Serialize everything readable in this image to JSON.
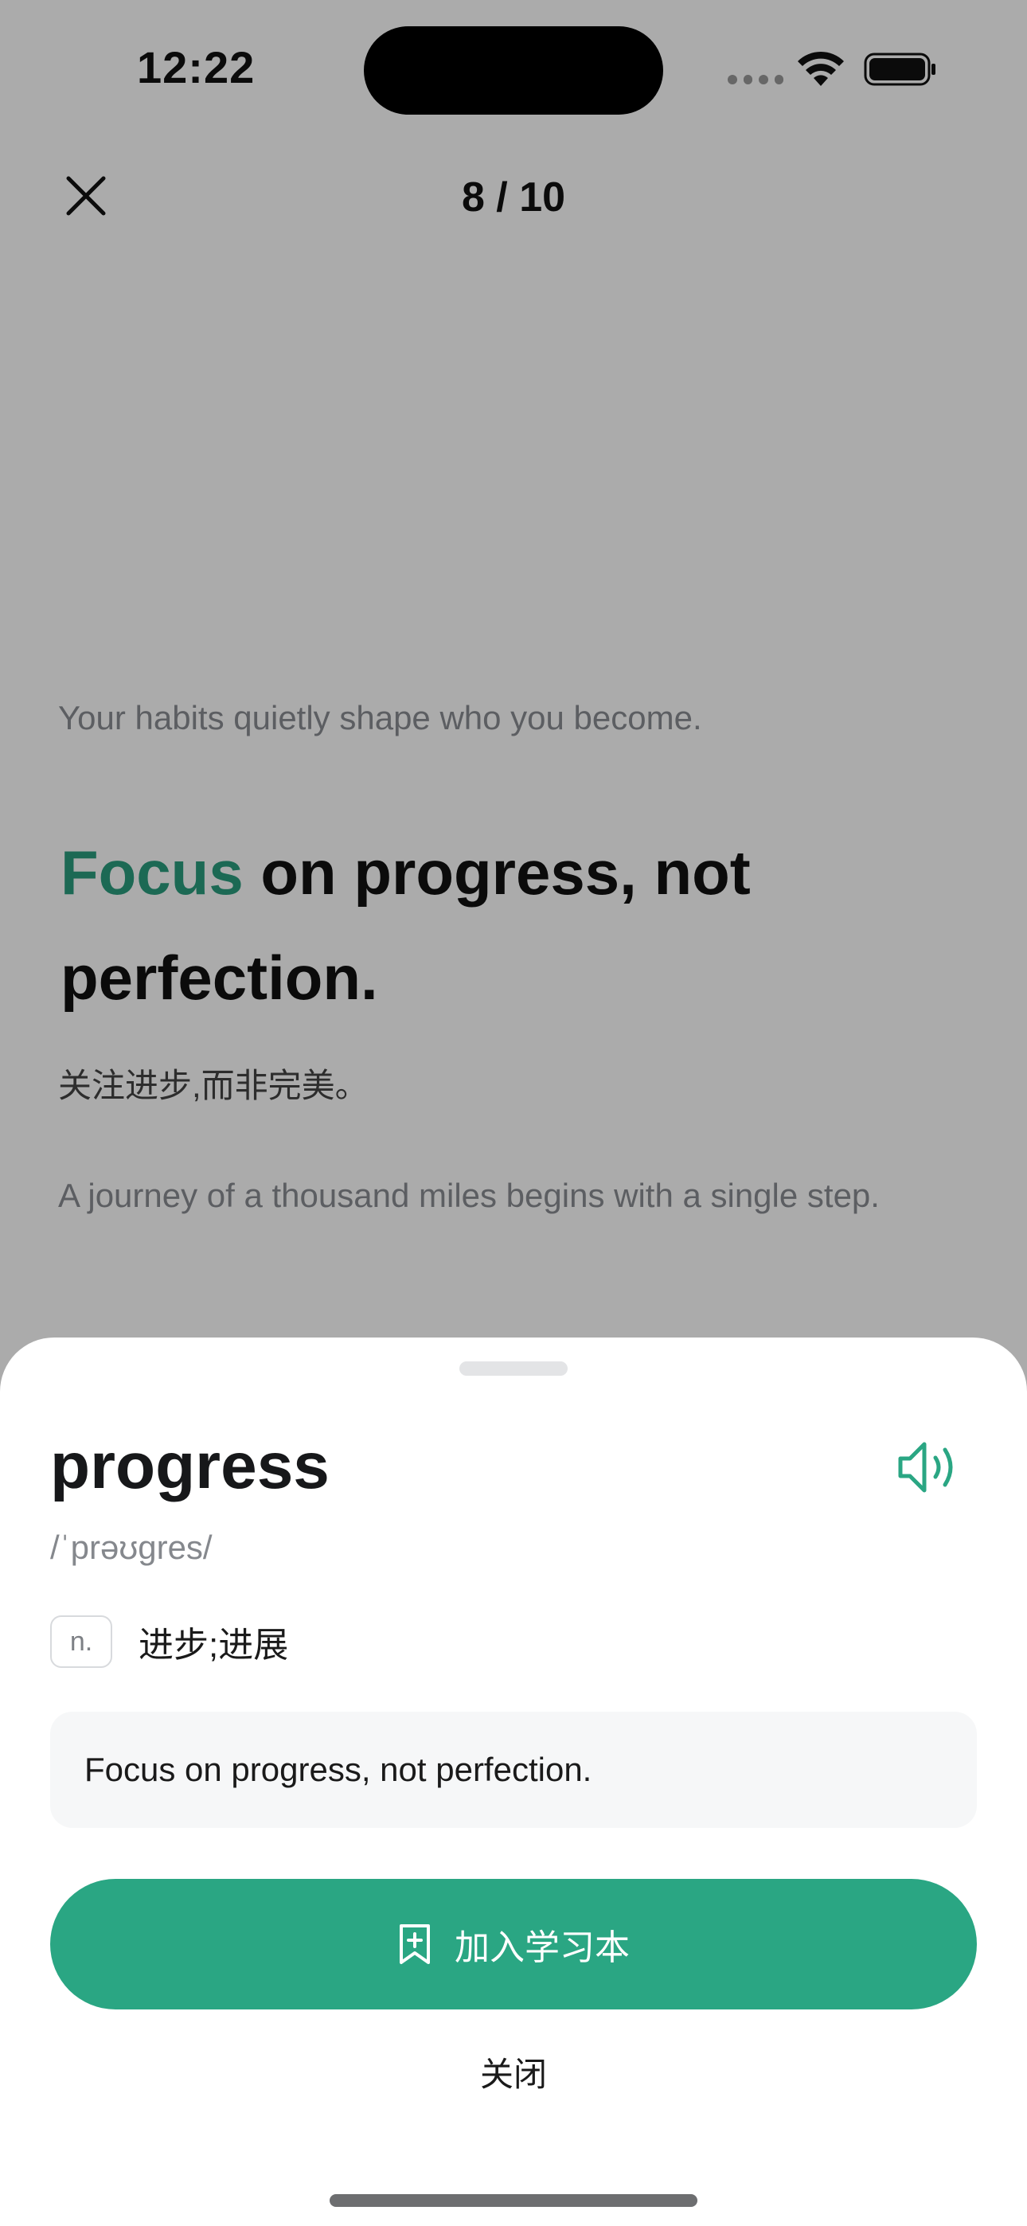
{
  "status_bar": {
    "time": "12:22"
  },
  "header": {
    "progress": "8 / 10",
    "close_icon": "close-icon"
  },
  "reader": {
    "previous_sentence": "Your habits quietly shape who you become.",
    "current_sentence": {
      "highlight": "Focus",
      "rest": " on progress, not perfection."
    },
    "translation": "关注进步,而非完美。",
    "next_sentence": "A journey of a thousand miles begins with a single step."
  },
  "word_sheet": {
    "word": "progress",
    "phonetic": "/ˈprəʊɡres/",
    "part_of_speech": "n.",
    "meaning": "进步;进展",
    "example": "Focus on progress, not perfection.",
    "add_button_label": "加入学习本",
    "close_label": "关闭",
    "speaker_icon": "speaker-icon",
    "bookmark_icon": "bookmark-add-icon"
  },
  "colors": {
    "accent": "#2aa683",
    "highlight_text": "#2a9d7e"
  }
}
